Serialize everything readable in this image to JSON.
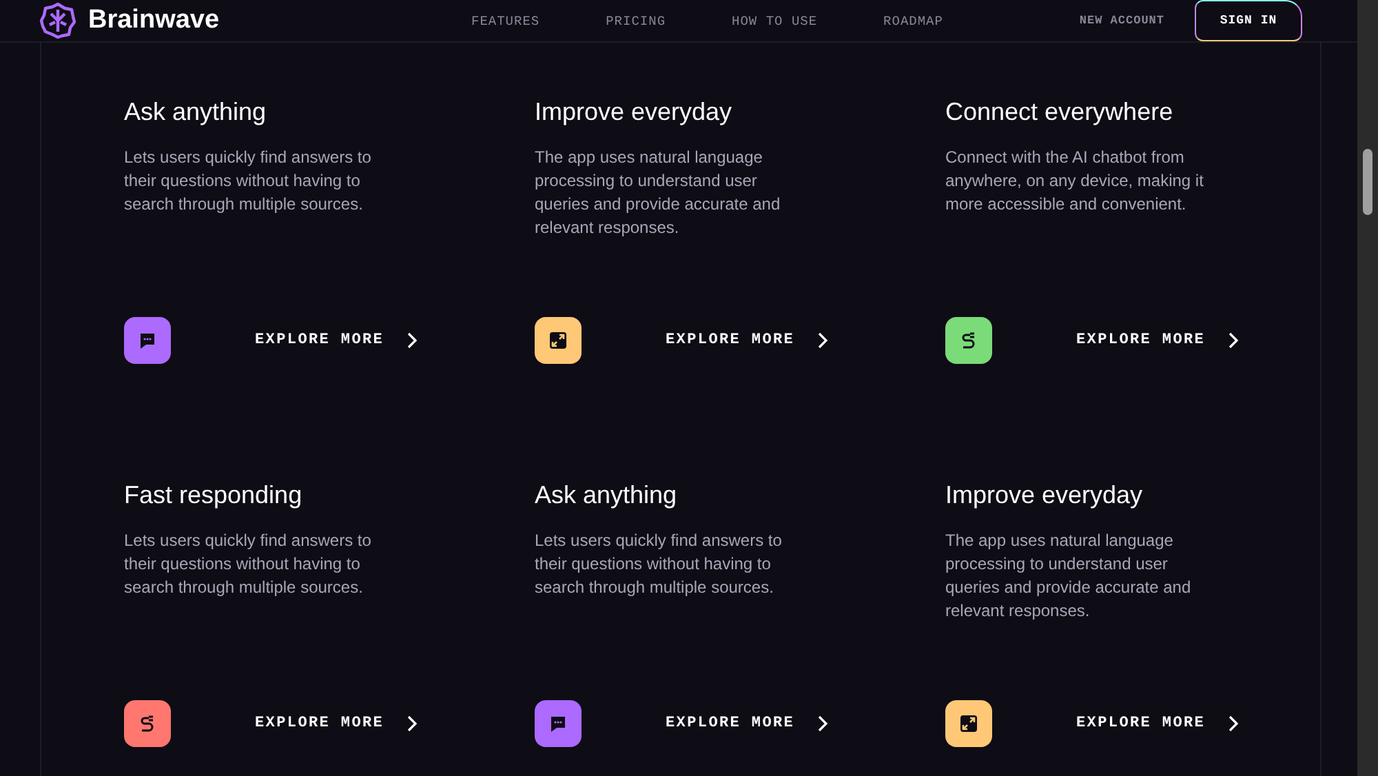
{
  "header": {
    "brand": "Brainwave",
    "nav": [
      {
        "label": "FEATURES",
        "selected": false
      },
      {
        "label": "PRICING",
        "selected": false
      },
      {
        "label": "HOW TO USE",
        "selected": false
      },
      {
        "label": "ROADMAP",
        "selected": false
      }
    ],
    "new_account": "NEW ACCOUNT",
    "sign_in": "SIGN IN"
  },
  "cards": [
    {
      "title": "Ask anything",
      "text": "Lets users quickly find answers to their questions without having to search through multiple sources.",
      "kind": "chat",
      "color": "#ac6aff",
      "link": "EXPLORE MORE"
    },
    {
      "title": "Improve everyday",
      "text": "The app uses natural language processing to understand user queries and provide accurate and relevant responses.",
      "kind": "expand",
      "color": "#ffc876",
      "link": "EXPLORE MORE"
    },
    {
      "title": "Connect everywhere",
      "text": "Connect with the AI chatbot from anywhere, on any device, making it more accessible and convenient.",
      "kind": "plug",
      "color": "#7adb78",
      "link": "EXPLORE MORE"
    },
    {
      "title": "Fast responding",
      "text": "Lets users quickly find answers to their questions without having to search through multiple sources.",
      "kind": "plug",
      "color": "#ff776f",
      "link": "EXPLORE MORE"
    },
    {
      "title": "Ask anything",
      "text": "Lets users quickly find answers to their questions without having to search through multiple sources.",
      "kind": "chat",
      "color": "#ac6aff",
      "link": "EXPLORE MORE"
    },
    {
      "title": "Improve everyday",
      "text": "The app uses natural language processing to understand user queries and provide accurate and relevant responses.",
      "kind": "expand",
      "color": "#ffc876",
      "link": "EXPLORE MORE"
    }
  ]
}
